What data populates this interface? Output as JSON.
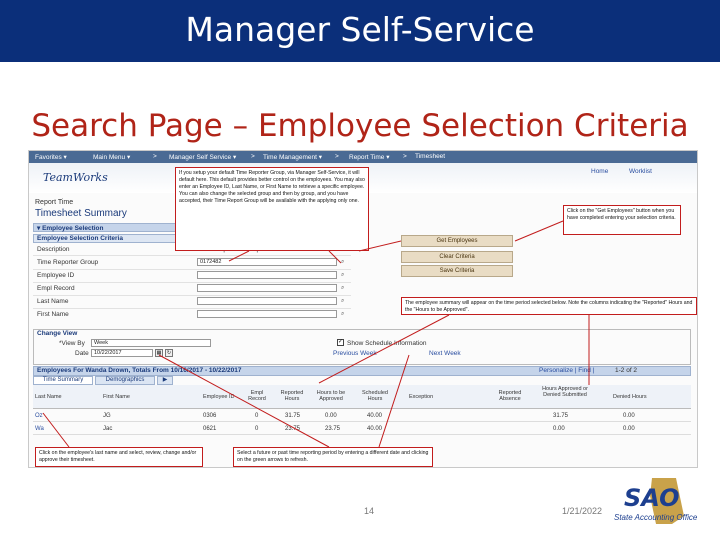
{
  "slide": {
    "title": "Manager Self-Service",
    "subtitle": "Search Page – Employee Selection Criteria",
    "page_number": "14",
    "date": "1/21/2022",
    "logo_text": "SAO",
    "logo_subtext": "State Accounting Office",
    "banner_color": "#0b2f7a",
    "subtitle_color": "#b02418"
  },
  "app": {
    "nav": {
      "favorites": "Favorites ▾",
      "main_menu": "Main Menu ▾",
      "sep1": ">",
      "mss": "Manager Self Service ▾",
      "sep2": ">",
      "time_mgmt": "Time Management ▾",
      "sep3": ">",
      "report_time": "Report Time ▾",
      "sep4": ">",
      "timesheet": "Timesheet"
    },
    "brand": "TeamWorks",
    "home": "Home",
    "worklist": "Worklist",
    "report_time_label": "Report Time",
    "page_title": "Timesheet Summary",
    "section_emp_sel": "▾ Employee Selection",
    "section_criteria": "Employee Selection Criteria",
    "criteria_col_description": "Description",
    "criteria_col_group": "Time Reporter Group",
    "criteria_fields": [
      {
        "label": "Time Reporter Group",
        "value": "0172482"
      },
      {
        "label": "Employee ID",
        "value": ""
      },
      {
        "label": "Empl Record",
        "value": ""
      },
      {
        "label": "Last Name",
        "value": ""
      },
      {
        "label": "First Name",
        "value": ""
      }
    ],
    "buttons": {
      "get_employees": "Get Employees",
      "clear_criteria": "Clear Criteria",
      "save_criteria": "Save Criteria"
    },
    "change_view": {
      "header": "Change View",
      "view_by_label": "*View By",
      "view_by_value": "Week",
      "date_label": "Date",
      "date_value": "10/22/2017",
      "show_schedule": "Show Schedule Information",
      "previous_week": "Previous Week",
      "next_week": "Next Week"
    },
    "grid": {
      "header": "Employees For Wanda Drown, Totals From 10/16/2017 - 10/22/2017",
      "personalize": "Personalize | Find | ",
      "pager": "1-2 of 2",
      "tabs": [
        "Time Summary",
        "Demographics",
        "▶"
      ],
      "columns": [
        "Last Name",
        "First Name",
        "Employee ID",
        "Empl Record",
        "Reported Hours",
        "Hours to be Approved",
        "Scheduled Hours",
        "Exception",
        "Reported Absence",
        "Hours Approved or Denied Submitted",
        "Denied Hours"
      ],
      "rows": [
        [
          "Oz",
          "JG",
          "0306",
          "0",
          "31.75",
          "0.00",
          "40.00",
          "",
          "",
          "31.75",
          "0.00"
        ],
        [
          "Wa",
          "Jac",
          "0621",
          "0",
          "23.75",
          "23.75",
          "40.00",
          "",
          "",
          "0.00",
          "0.00"
        ]
      ]
    }
  },
  "callouts": {
    "time_reporter": "If you setup your default Time Reporter Group, via Manager Self-Service, it will default here. This default provides better control on the employees. You may also enter an Employee ID, Last Name, or First Name to retrieve a specific employee. You can also change the selected group and then by group, and you have accepted, their Time Report Group will be available with the applying only one.",
    "get_employees": "Click on the \"Get Employees\" button when you have completed entering your selection criteria.",
    "summary": "The employee summary will appear on the time period selected below. Note the columns indicating the \"Reported\" Hours and the \"Hours to be Approved\".",
    "employee": "Click on the employee's last name and select, review, change and/or approve their timesheet.",
    "period": "Select a future or past time reporting period by entering a different date and clicking on the green arrows to refresh."
  }
}
